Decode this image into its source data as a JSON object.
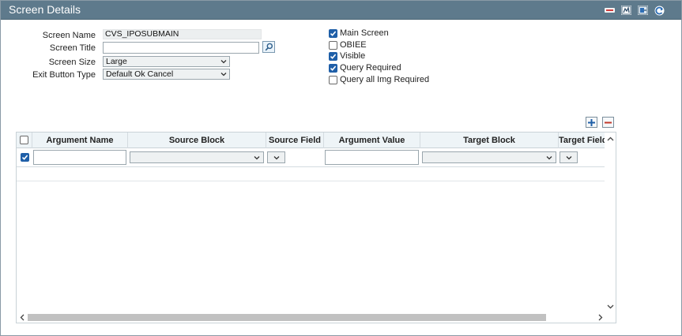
{
  "window": {
    "title": "Screen Details"
  },
  "toolbar_icons": [
    "minus-icon",
    "report-icon",
    "export-icon",
    "refresh-icon"
  ],
  "form": {
    "screen_name_label": "Screen Name",
    "screen_name_value": "CVS_IPOSUBMAIN",
    "screen_title_label": "Screen Title",
    "screen_title_value": "",
    "screen_size_label": "Screen Size",
    "screen_size_value": "Large",
    "exit_button_label": "Exit Button Type",
    "exit_button_value": "Default Ok Cancel"
  },
  "options": [
    {
      "label": "Main Screen",
      "checked": true
    },
    {
      "label": "OBIEE",
      "checked": false
    },
    {
      "label": "Visible",
      "checked": true
    },
    {
      "label": "Query Required",
      "checked": true
    },
    {
      "label": "Query all Img Required",
      "checked": false
    }
  ],
  "grid": {
    "columns": [
      "Argument Name",
      "Source Block",
      "Source Field",
      "Argument Value",
      "Target Block",
      "Target Field"
    ],
    "rows": [
      {
        "selected": true,
        "argument_name": "",
        "source_block": "",
        "source_field": "",
        "argument_value": "",
        "target_block": "",
        "target_field": ""
      }
    ]
  },
  "colors": {
    "titlebar": "#5e7a8c",
    "checkbox_checked": "#1f5fa8",
    "add_icon": "#1f5fa8",
    "remove_icon": "#c0392b"
  }
}
